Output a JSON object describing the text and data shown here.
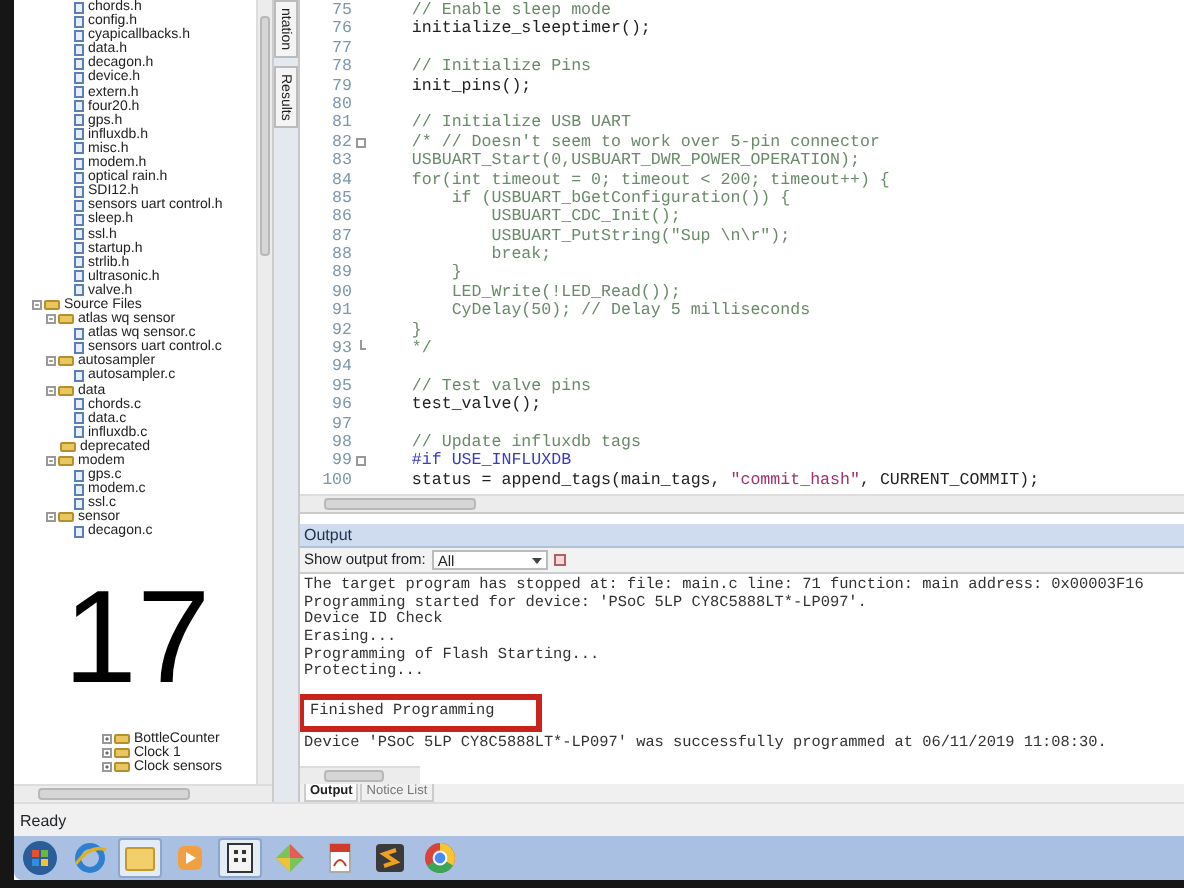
{
  "tree": {
    "header_files": [
      "chords.h",
      "config.h",
      "cyapicallbacks.h",
      "data.h",
      "decagon.h",
      "device.h",
      "extern.h",
      "four20.h",
      "gps.h",
      "influxdb.h",
      "misc.h",
      "modem.h",
      "optical rain.h",
      "SDI12.h",
      "sensors uart control.h",
      "sleep.h",
      "ssl.h",
      "startup.h",
      "strlib.h",
      "ultrasonic.h",
      "valve.h"
    ],
    "source_files": {
      "label": "Source Files",
      "kind": "folder",
      "expanded": true,
      "children": [
        {
          "label": "atlas wq sensor",
          "kind": "folder",
          "expanded": true,
          "children": [
            {
              "label": "atlas wq sensor.c",
              "kind": "file"
            },
            {
              "label": "sensors uart control.c",
              "kind": "file"
            }
          ]
        },
        {
          "label": "autosampler",
          "kind": "folder",
          "expanded": true,
          "children": [
            {
              "label": "autosampler.c",
              "kind": "file"
            }
          ]
        },
        {
          "label": "data",
          "kind": "folder",
          "expanded": true,
          "children": [
            {
              "label": "chords.c",
              "kind": "file"
            },
            {
              "label": "data.c",
              "kind": "file"
            },
            {
              "label": "influxdb.c",
              "kind": "file"
            }
          ]
        },
        {
          "label": "deprecated",
          "kind": "folder"
        },
        {
          "label": "modem",
          "kind": "folder",
          "expanded": true,
          "children": [
            {
              "label": "gps.c",
              "kind": "file"
            },
            {
              "label": "modem.c",
              "kind": "file"
            },
            {
              "label": "ssl.c",
              "kind": "file"
            }
          ]
        },
        {
          "label": "sensor",
          "kind": "folder",
          "expanded": true,
          "children": [
            {
              "label": "decagon.c",
              "kind": "file"
            }
          ]
        }
      ]
    },
    "components": [
      {
        "label": "BottleCounter",
        "kind": "folder",
        "expanded": false
      },
      {
        "label": "Clock 1",
        "kind": "folder",
        "expanded": false
      },
      {
        "label": "Clock sensors",
        "kind": "folder",
        "expanded": false
      }
    ]
  },
  "step_number": "17",
  "side_tabs": [
    {
      "label": "ntation",
      "selected": false
    },
    {
      "label": "Results",
      "selected": false
    }
  ],
  "editor": {
    "lines": [
      {
        "number": "75",
        "segments": [
          {
            "text": "    // Enable sleep mode",
            "kind": "comment"
          }
        ]
      },
      {
        "number": "76",
        "segments": [
          {
            "text": "    initialize_sleeptimer();",
            "kind": "code"
          }
        ]
      },
      {
        "number": "77"
      },
      {
        "number": "78",
        "segments": [
          {
            "text": "    // Initialize Pins",
            "kind": "comment"
          }
        ]
      },
      {
        "number": "79",
        "segments": [
          {
            "text": "    init_pins();",
            "kind": "code"
          }
        ]
      },
      {
        "number": "80"
      },
      {
        "number": "81",
        "segments": [
          {
            "text": "    // Initialize USB UART",
            "kind": "comment"
          }
        ]
      },
      {
        "number": "82",
        "fold_start": true,
        "segments": [
          {
            "text": "    /* // Doesn't seem to work over 5-pin connector",
            "kind": "comment"
          }
        ]
      },
      {
        "number": "83",
        "segments": [
          {
            "text": "    USBUART_Start(0,USBUART_DWR_POWER_OPERATION);",
            "kind": "comment"
          }
        ]
      },
      {
        "number": "84",
        "segments": [
          {
            "text": "    for(int timeout = 0; timeout < 200; timeout++) {",
            "kind": "comment"
          }
        ]
      },
      {
        "number": "85",
        "segments": [
          {
            "text": "        if (USBUART_bGetConfiguration()) {",
            "kind": "comment"
          }
        ]
      },
      {
        "number": "86",
        "segments": [
          {
            "text": "            USBUART_CDC_Init();",
            "kind": "comment"
          }
        ]
      },
      {
        "number": "87",
        "segments": [
          {
            "text": "            USBUART_PutString(\"Sup \\n\\r\");",
            "kind": "comment"
          }
        ]
      },
      {
        "number": "88",
        "segments": [
          {
            "text": "            break;",
            "kind": "comment"
          }
        ]
      },
      {
        "number": "89",
        "segments": [
          {
            "text": "        }",
            "kind": "comment"
          }
        ]
      },
      {
        "number": "90",
        "segments": [
          {
            "text": "        LED_Write(!LED_Read());",
            "kind": "comment"
          }
        ]
      },
      {
        "number": "91",
        "segments": [
          {
            "text": "        CyDelay(50); // Delay 5 milliseconds",
            "kind": "comment"
          }
        ]
      },
      {
        "number": "92",
        "segments": [
          {
            "text": "    }",
            "kind": "comment"
          }
        ]
      },
      {
        "number": "93",
        "fold_end": true,
        "segments": [
          {
            "text": "    */",
            "kind": "comment"
          }
        ]
      },
      {
        "number": "94"
      },
      {
        "number": "95",
        "segments": [
          {
            "text": "    // Test valve pins",
            "kind": "comment"
          }
        ]
      },
      {
        "number": "96",
        "segments": [
          {
            "text": "    test_valve();",
            "kind": "code"
          }
        ]
      },
      {
        "number": "97"
      },
      {
        "number": "98",
        "segments": [
          {
            "text": "    // Update influxdb tags",
            "kind": "comment"
          }
        ]
      },
      {
        "number": "99",
        "fold_start": true,
        "segments": [
          {
            "text": "    #if USE_INFLUXDB",
            "kind": "directive"
          }
        ]
      },
      {
        "number": "100",
        "segments": [
          {
            "text": "    status = append_tags(main_tags, ",
            "kind": "code"
          },
          {
            "text": "\"commit_hash\"",
            "kind": "string"
          },
          {
            "text": ", CURRENT_COMMIT);",
            "kind": "code"
          }
        ]
      }
    ]
  },
  "output": {
    "title": "Output",
    "show_from_label": "Show output from:",
    "show_from_value": "All",
    "lines": [
      {
        "text": "The target program has stopped at: file: main.c line: 71 function: main address: 0x00003F16",
        "highlighted": false
      },
      {
        "text": "Programming started for device: 'PSoC 5LP CY8C5888LT*-LP097'.",
        "highlighted": false
      },
      {
        "text": "Device ID Check",
        "highlighted": false
      },
      {
        "text": "Erasing...",
        "highlighted": false
      },
      {
        "text": "Programming of Flash Starting...",
        "highlighted": false
      },
      {
        "text": "Protecting...",
        "highlighted": false
      },
      {
        "text": "Finished Programming",
        "highlighted": true
      },
      {
        "text": "Device 'PSoC 5LP CY8C5888LT*-LP097' was successfully programmed at 06/11/2019 11:08:30.",
        "highlighted": false
      }
    ],
    "tabs": [
      {
        "label": "Output",
        "selected": true
      },
      {
        "label": "Notice List",
        "selected": false
      }
    ]
  },
  "status_bar": {
    "text": "Ready"
  }
}
